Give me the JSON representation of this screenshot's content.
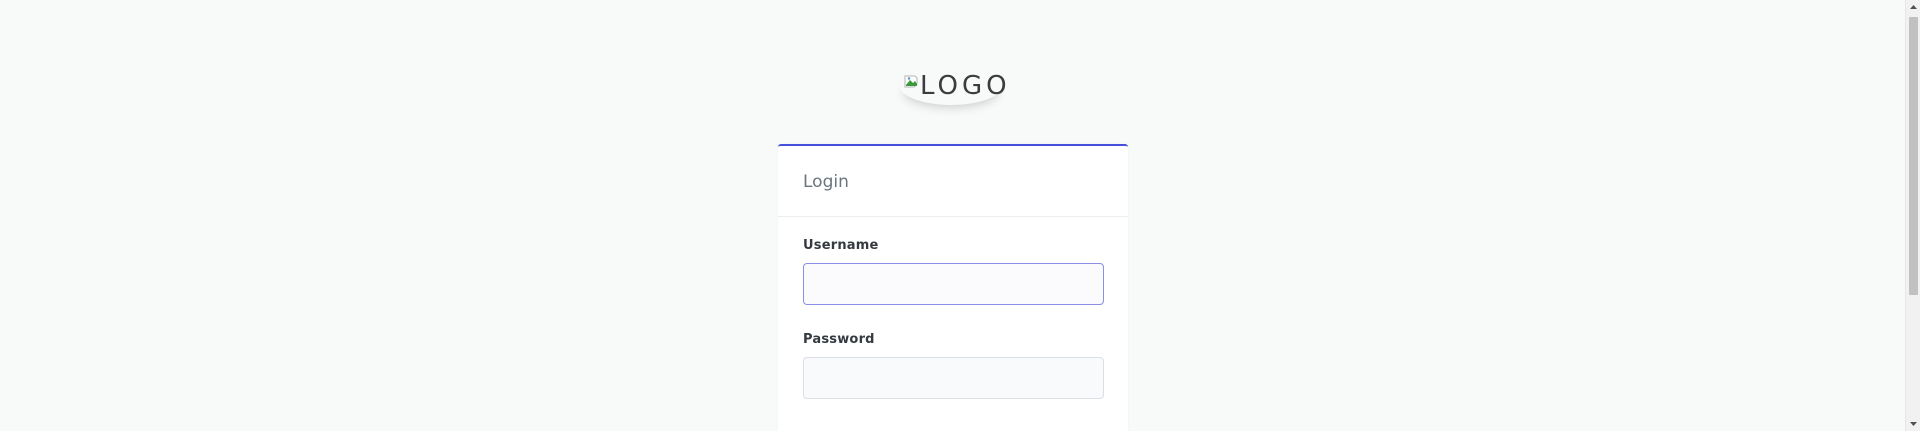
{
  "logo": {
    "alt_text": "LOGO",
    "icon": "broken-image-icon"
  },
  "login_card": {
    "title": "Login",
    "accent_color": "#4650dd"
  },
  "form": {
    "username_label": "Username",
    "username_value": "",
    "password_label": "Password",
    "password_value": ""
  },
  "scrollbar": {
    "up_icon": "scroll-up-arrow-icon",
    "down_icon": "scroll-down-arrow-icon"
  }
}
